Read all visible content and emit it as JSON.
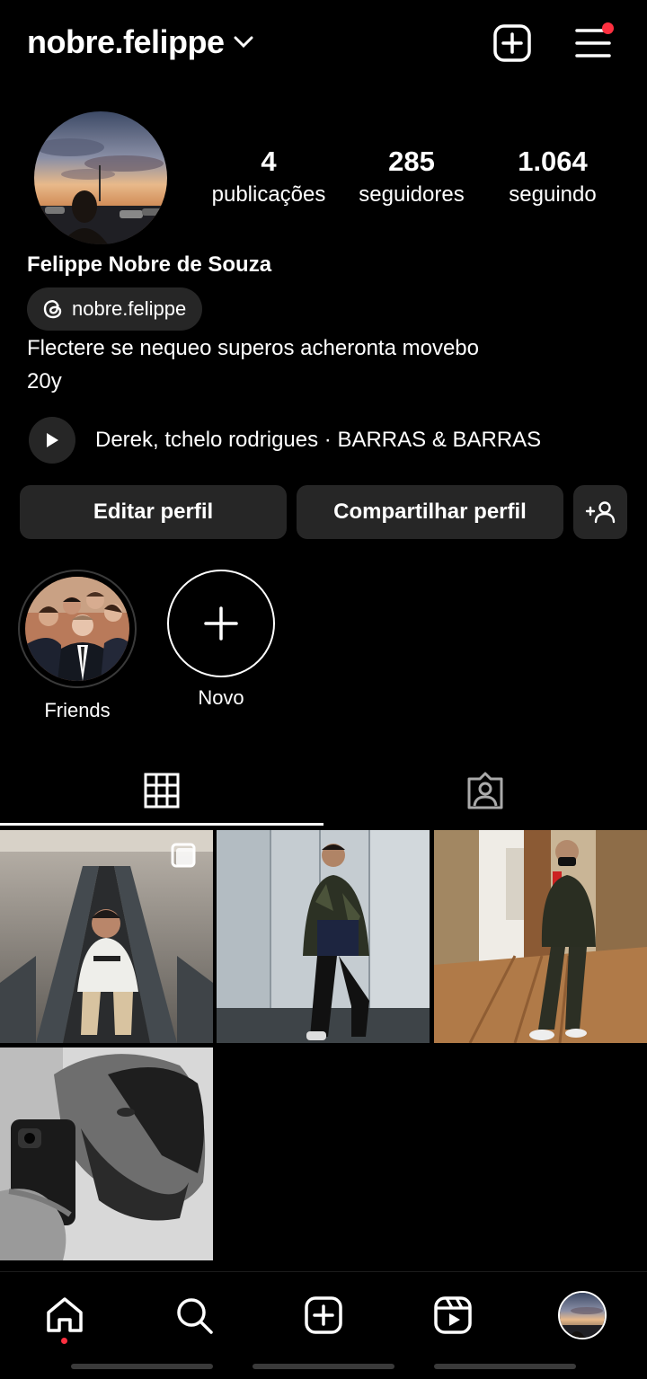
{
  "header": {
    "username": "nobre.felippe",
    "add_icon": "plus-square-icon",
    "menu_icon": "hamburger-menu-icon"
  },
  "profile": {
    "stats": [
      {
        "value": "4",
        "label": "publicações"
      },
      {
        "value": "285",
        "label": "seguidores"
      },
      {
        "value": "1.064",
        "label": "seguindo"
      }
    ],
    "full_name": "Felippe Nobre de Souza",
    "threads_handle": "nobre.felippe",
    "bio_line1": "Flectere se nequeo superos acheronta movebo",
    "bio_line2": "20y",
    "music": "Derek, tchelo rodrigues · BARRAS & BARRAS"
  },
  "actions": {
    "edit": "Editar perfil",
    "share": "Compartilhar perfil",
    "discover_icon": "add-person-icon"
  },
  "highlights": [
    {
      "label": "Friends"
    },
    {
      "label": "Novo"
    }
  ],
  "tabs": [
    {
      "name": "grid",
      "icon": "grid-icon",
      "active": true
    },
    {
      "name": "tagged",
      "icon": "tagged-person-icon",
      "active": false
    }
  ],
  "bottom_nav": [
    "home-icon",
    "search-icon",
    "create-icon",
    "reels-icon",
    "profile-avatar"
  ],
  "colors": {
    "background": "#000000",
    "button": "#262626",
    "notification": "#ff3040"
  }
}
